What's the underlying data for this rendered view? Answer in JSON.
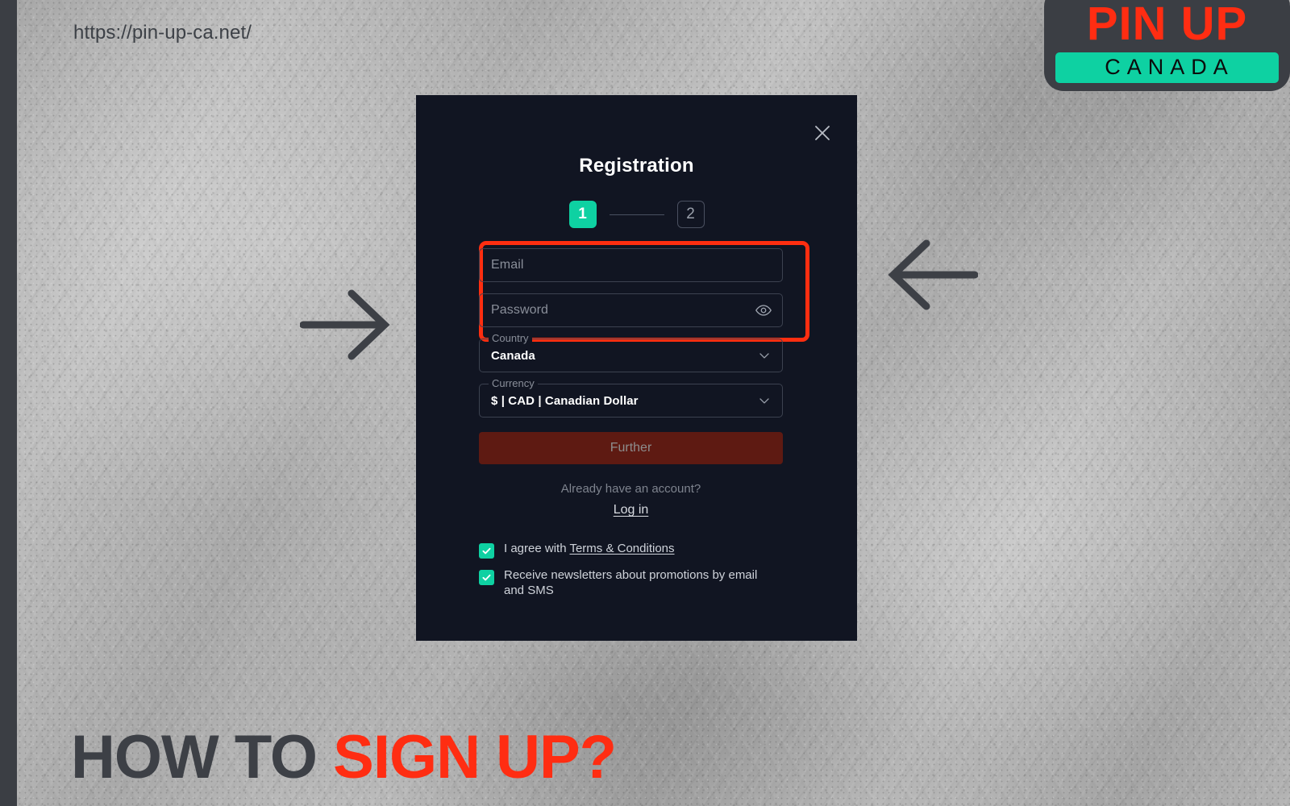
{
  "page": {
    "url_caption": "https://pin-up-ca.net/",
    "heading_part1": "HOW TO ",
    "heading_part2": "SIGN UP?",
    "accent_red": "#ff2d12",
    "accent_teal": "#0ed1a2",
    "dark_gray": "#3b3e44",
    "modal_bg": "#111522",
    "highlight_color": "#ff2e10"
  },
  "logo": {
    "top_text": "PIN UP",
    "bottom_text": "CANADA"
  },
  "annotations": {
    "arrow_right_name": "arrow-right-icon",
    "arrow_left_name": "arrow-left-icon",
    "highlight_target": "email-and-password-fields"
  },
  "modal": {
    "title": "Registration",
    "close_label": "×",
    "steps": [
      {
        "label": "1",
        "state": "active"
      },
      {
        "label": "2",
        "state": "idle"
      }
    ],
    "fields": {
      "email": {
        "placeholder": "Email",
        "value": ""
      },
      "password": {
        "placeholder": "Password",
        "value": "",
        "toggle_icon": "eye-icon"
      },
      "country": {
        "legend": "Country",
        "value": "Canada"
      },
      "currency": {
        "legend": "Currency",
        "value": "$ | CAD | Canadian Dollar"
      }
    },
    "submit_label": "Further",
    "submit_disabled": true,
    "have_account_text": "Already have an account?",
    "login_label": "Log in",
    "checkboxes": [
      {
        "checked": true,
        "text_before": "I agree with ",
        "link_text": "Terms & Conditions",
        "text_after": ""
      },
      {
        "checked": true,
        "text_before": "Receive newsletters about promotions by email and SMS",
        "link_text": "",
        "text_after": ""
      }
    ]
  }
}
